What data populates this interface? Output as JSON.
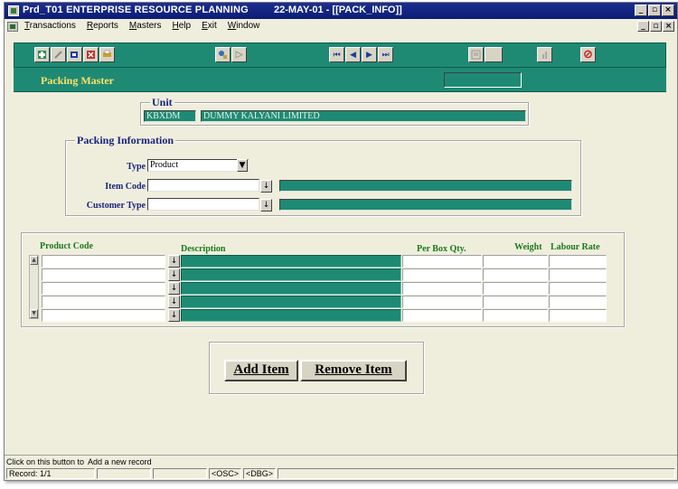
{
  "titlebar": {
    "title": "Prd_T01  ENTERPRISE RESOURCE PLANNING",
    "date_info": "22-MAY-01 - [[PACK_INFO]]",
    "minimize": "_",
    "restore": "▫",
    "close": "×"
  },
  "menubar": {
    "items": [
      {
        "underline": "T",
        "rest": "ransactions"
      },
      {
        "underline": "R",
        "rest": "eports"
      },
      {
        "underline": "M",
        "rest": "asters"
      },
      {
        "underline": "H",
        "rest": "elp"
      },
      {
        "underline": "E",
        "rest": "xit"
      },
      {
        "underline": "W",
        "rest": "indow"
      }
    ]
  },
  "toolbar": {
    "first": "⏮",
    "prev": "◀",
    "next": "▶",
    "last": "⏭",
    "cancel": "⊘"
  },
  "form": {
    "title": "Packing Master"
  },
  "unit": {
    "legend": "Unit",
    "code": "KBXDM",
    "name": "DUMMY KALYANI LIMITED"
  },
  "packing_info": {
    "legend": "Packing Information",
    "type_label": "Type",
    "type_value": "Product",
    "item_code_label": "Item Code",
    "item_code_value": "",
    "customer_type_label": "Customer Type",
    "customer_type_value": "",
    "dropdown_glyph": "▼",
    "lov_glyph": "↓"
  },
  "grid": {
    "columns": [
      "Product Code",
      "Description",
      "Per Box Qty.",
      "Weight",
      "Labour Rate"
    ],
    "row_count": 5
  },
  "actions": {
    "add_item": "Add Item",
    "remove_item": "Remove Item"
  },
  "status": {
    "hint_prefix": "Click on this button to",
    "hint_text": "Add a new record",
    "record": "Record: 1/1",
    "osc": "<OSC>",
    "dbg": "<DBG>"
  },
  "colors": {
    "teal": "#1e8a74",
    "title_blue": "#0b1c74",
    "label_navy": "#1a237e",
    "header_green": "#1b7a1b",
    "form_title_yellow": "#ffe066",
    "background": "#efeedd"
  }
}
